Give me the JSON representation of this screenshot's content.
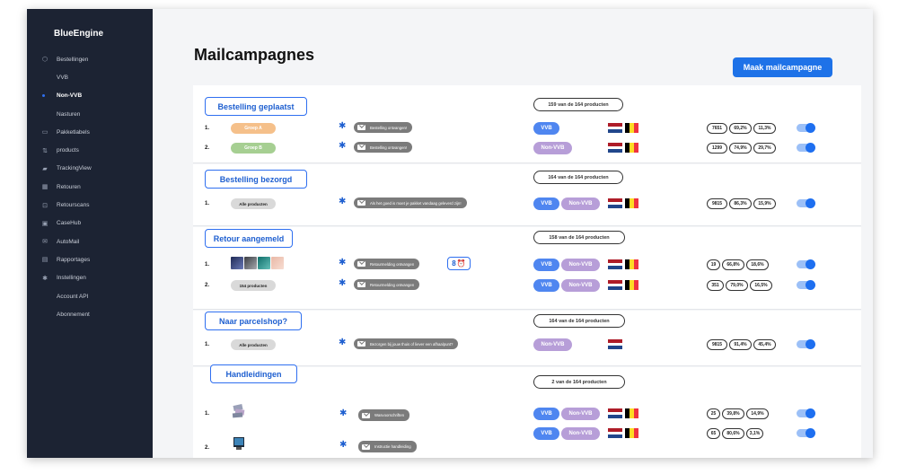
{
  "app": {
    "brand": "BlueEngine"
  },
  "sidebar": {
    "items": [
      {
        "label": "Bestellingen",
        "icon": "cube-icon"
      },
      {
        "label": "VVB",
        "sub": true
      },
      {
        "label": "Non-VVB",
        "sub": true,
        "active": true
      },
      {
        "label": "Nasturen",
        "sub": true
      },
      {
        "label": "Pakketlabels",
        "icon": "label-icon"
      },
      {
        "label": "products",
        "icon": "sort-icon"
      },
      {
        "label": "TrackingView",
        "icon": "truck-icon"
      },
      {
        "label": "Retouren",
        "icon": "grid-icon"
      },
      {
        "label": "Retourscans",
        "icon": "scan-icon"
      },
      {
        "label": "CaseHub",
        "icon": "case-icon"
      },
      {
        "label": "AutoMail",
        "icon": "mail-icon"
      },
      {
        "label": "Rapportages",
        "icon": "report-icon"
      },
      {
        "label": "Instellingen",
        "icon": "gear-icon"
      },
      {
        "label": "Account API",
        "sub": true
      },
      {
        "label": "Abonnement",
        "sub": true
      }
    ]
  },
  "header": {
    "title": "Mailcampagnes",
    "create_button": "Maak mailcampagne"
  },
  "colors": {
    "primary": "#1e72e8",
    "vvb": "#4f86f0",
    "non_vvb": "#b79ed8",
    "sidebar": "#1c2333"
  },
  "campaigns": [
    {
      "title": "Bestelling geplaatst",
      "count": "159 van de 164 producten",
      "rows": [
        {
          "num": "1.",
          "group": "Groep A",
          "mail": "Bestelling ontvangen!",
          "tags": [
            "VVB"
          ],
          "flags": [
            "nl",
            "be"
          ],
          "stats": [
            "7651",
            "69,2%",
            "11,3%"
          ],
          "enabled": true
        },
        {
          "num": "2.",
          "group": "Groep B",
          "mail": "Bestelling ontvangen!",
          "tags": [
            "Non-VVB"
          ],
          "flags": [
            "nl",
            "be"
          ],
          "stats": [
            "1299",
            "74,9%",
            "29,7%"
          ],
          "enabled": true
        }
      ]
    },
    {
      "title": "Bestelling bezorgd",
      "count": "164 van de 164 producten",
      "rows": [
        {
          "num": "1.",
          "group": "Alle producten",
          "mail": "Als het goed is moet je pakket vandaag geleverd zijn!",
          "tags": [
            "VVB",
            "Non-VVB"
          ],
          "flags": [
            "nl",
            "be"
          ],
          "stats": [
            "9815",
            "86,3%",
            "15,9%"
          ],
          "enabled": true
        }
      ]
    },
    {
      "title": "Retour aangemeld",
      "count": "158 van de 164 producten",
      "rows": [
        {
          "num": "1.",
          "group": "",
          "mail": "Retourmelding ontvangen",
          "alarm": "8",
          "tags": [
            "VVB",
            "Non-VVB"
          ],
          "flags": [
            "nl",
            "be"
          ],
          "stats": [
            "19",
            "66,8%",
            "18,6%"
          ],
          "enabled": true
        },
        {
          "num": "2.",
          "group": "154 producten",
          "mail": "Retourmelding ontvangen",
          "tags": [
            "VVB",
            "Non-VVB"
          ],
          "flags": [
            "nl",
            "be"
          ],
          "stats": [
            "351",
            "79,0%",
            "16,5%"
          ],
          "enabled": true
        }
      ]
    },
    {
      "title": "Naar parcelshop?",
      "count": "164 van de 164 producten",
      "rows": [
        {
          "num": "1.",
          "group": "Alle producten",
          "mail": "Bezorgen bij jouw thuis of liever een afhaalpunt?",
          "tags": [
            "Non-VVB"
          ],
          "flags": [
            "nl"
          ],
          "stats": [
            "9815",
            "91,4%",
            "45,4%"
          ],
          "enabled": true
        }
      ]
    },
    {
      "title": "Handleidingen",
      "count": "2 van de 164 producten",
      "rows": [
        {
          "num": "1.",
          "group": "",
          "mail": "Wasvoorschriften",
          "tags": [
            "VVB",
            "Non-VVB"
          ],
          "flags": [
            "nl",
            "be"
          ],
          "stats": [
            "25",
            "39,8%",
            "14,9%"
          ],
          "enabled": true
        },
        {
          "num": "2.",
          "group": "",
          "mail": "Instructie handleiding",
          "tags": [
            "VVB",
            "Non-VVB"
          ],
          "flags": [
            "nl",
            "be"
          ],
          "stats": [
            "65",
            "80,6%",
            "3,1%"
          ],
          "enabled": true
        }
      ]
    }
  ]
}
